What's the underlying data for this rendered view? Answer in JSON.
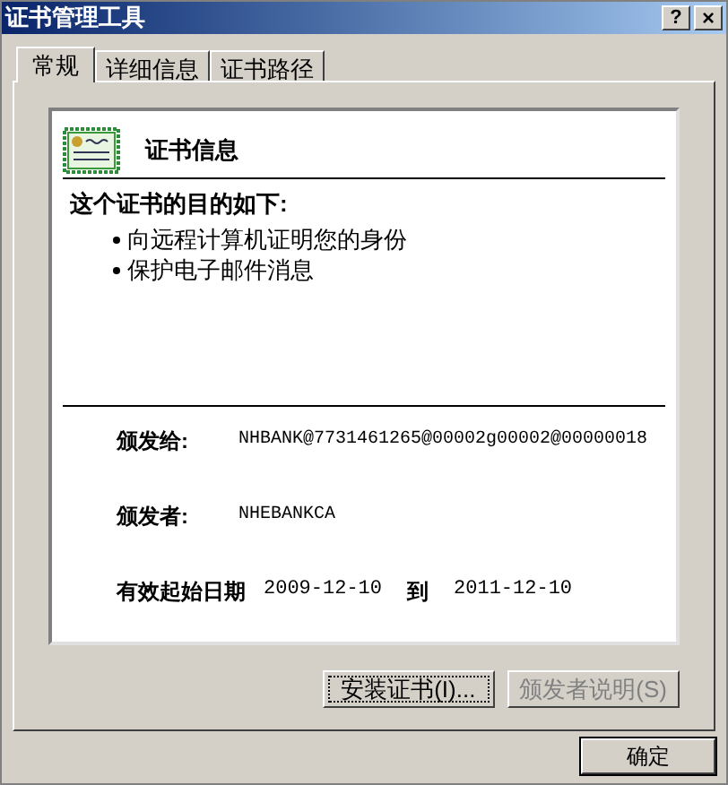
{
  "window": {
    "title": "证书管理工具",
    "help_button": "?",
    "close_button": "×"
  },
  "tabs": [
    {
      "label": "常规",
      "selected": true
    },
    {
      "label": "详细信息",
      "selected": false
    },
    {
      "label": "证书路径",
      "selected": false
    }
  ],
  "certificate": {
    "heading": "证书信息",
    "purpose_title": "这个证书的目的如下:",
    "purposes": [
      "向远程计算机证明您的身份",
      "保护电子邮件消息"
    ],
    "issued_to_label": "颁发给:",
    "issued_to": "NHBANK@7731461265@00002g00002@00000018",
    "issued_by_label": "颁发者:",
    "issued_by": "NHEBANKCA",
    "valid_label": "有效起始日期",
    "valid_from": "2009-12-10",
    "valid_to_label": "到",
    "valid_to": "2011-12-10"
  },
  "buttons": [
    {
      "label": "安装证书(I)...",
      "disabled": false,
      "focused": true
    },
    {
      "label": "颁发者说明(S)",
      "disabled": true,
      "focused": false
    }
  ],
  "ok_button": {
    "label": "确定"
  }
}
